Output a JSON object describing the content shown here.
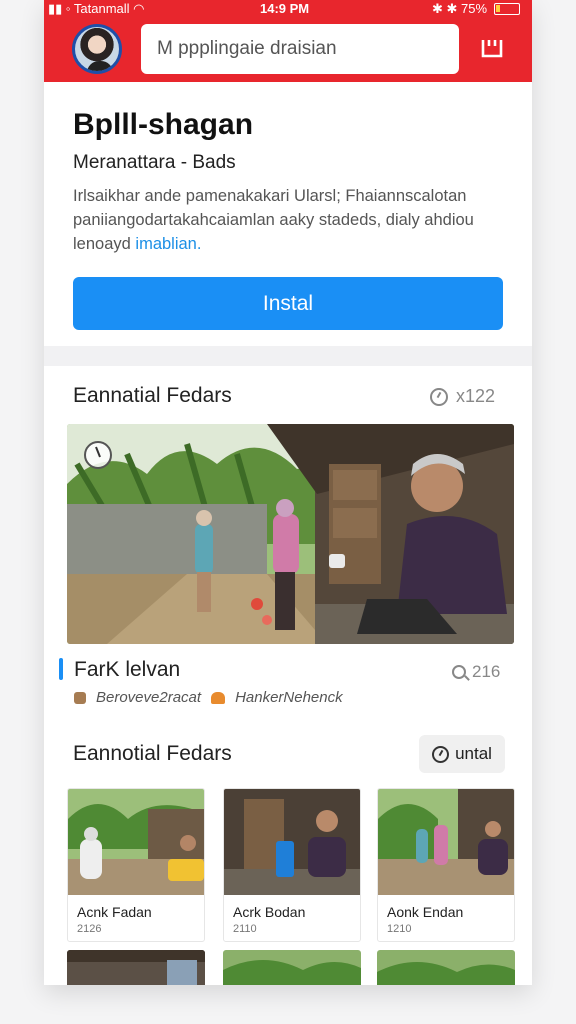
{
  "status": {
    "carrier": "Tatanmall",
    "time": "14:9 PM",
    "battery": "75%"
  },
  "header": {
    "search_text": "M ppplingaie draisian",
    "avatar_alt": "profile avatar",
    "icons": [
      "grid-icon"
    ]
  },
  "app": {
    "title": "Bplll‑shagan",
    "subtitle": "Meranattara - Bads",
    "description": "Irlsaikhar ande pamenakakari Ularsl; Fhaiannscalotan paniiangodartakahcaiamlan aaky stadeds, dialy ahdiou lenoayd",
    "description_link": "imablian.",
    "install_label": "Instal"
  },
  "featured": {
    "title": "Eannatial Fedars",
    "count": "x122",
    "post_title": "FarK lelvan",
    "post_count": "216",
    "author_a": "Beroveve2racat",
    "author_b": "HankerNehenck"
  },
  "section2": {
    "title": "Eannotial Fedars",
    "button_label": "untal",
    "tiles": [
      {
        "title": "Acnk Fadan",
        "num": "2126"
      },
      {
        "title": "Acrk Bodan",
        "num": "2110"
      },
      {
        "title": "Aonk Endan",
        "num": "1210"
      }
    ]
  },
  "colors": {
    "brand_red": "#e8262d",
    "install_blue": "#1a8ff5"
  }
}
